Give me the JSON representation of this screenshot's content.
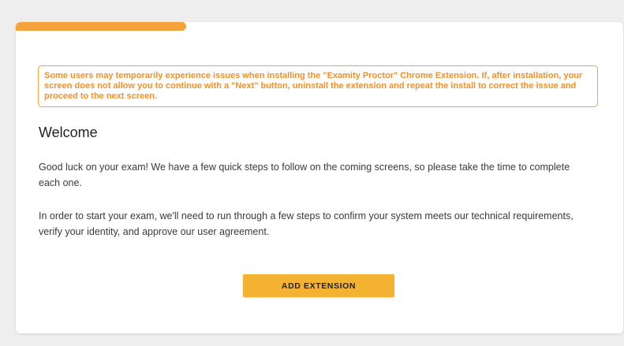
{
  "progress": {
    "fraction": 0.28,
    "color": "#f5a23a"
  },
  "notice": {
    "text": "Some users may temporarily experience issues when installing the \"Examity Proctor\" Chrome Extension. If, after installation, your screen does not allow you to continue with a \"Next\" button, uninstall the extension and repeat the install to correct the issue and proceed to the next screen.",
    "color": "#f5902a"
  },
  "welcome": {
    "title": "Welcome",
    "paragraph1": "Good luck on your exam! We have a few quick steps to follow on the coming screens, so please take the time to complete each one.",
    "paragraph2": "In order to start your exam, we'll need to run through a few steps to confirm your system meets our technical requirements, verify your identity, and approve our user agreement."
  },
  "actions": {
    "add_extension_label": "ADD EXTENSION",
    "button_color": "#f4b233"
  }
}
